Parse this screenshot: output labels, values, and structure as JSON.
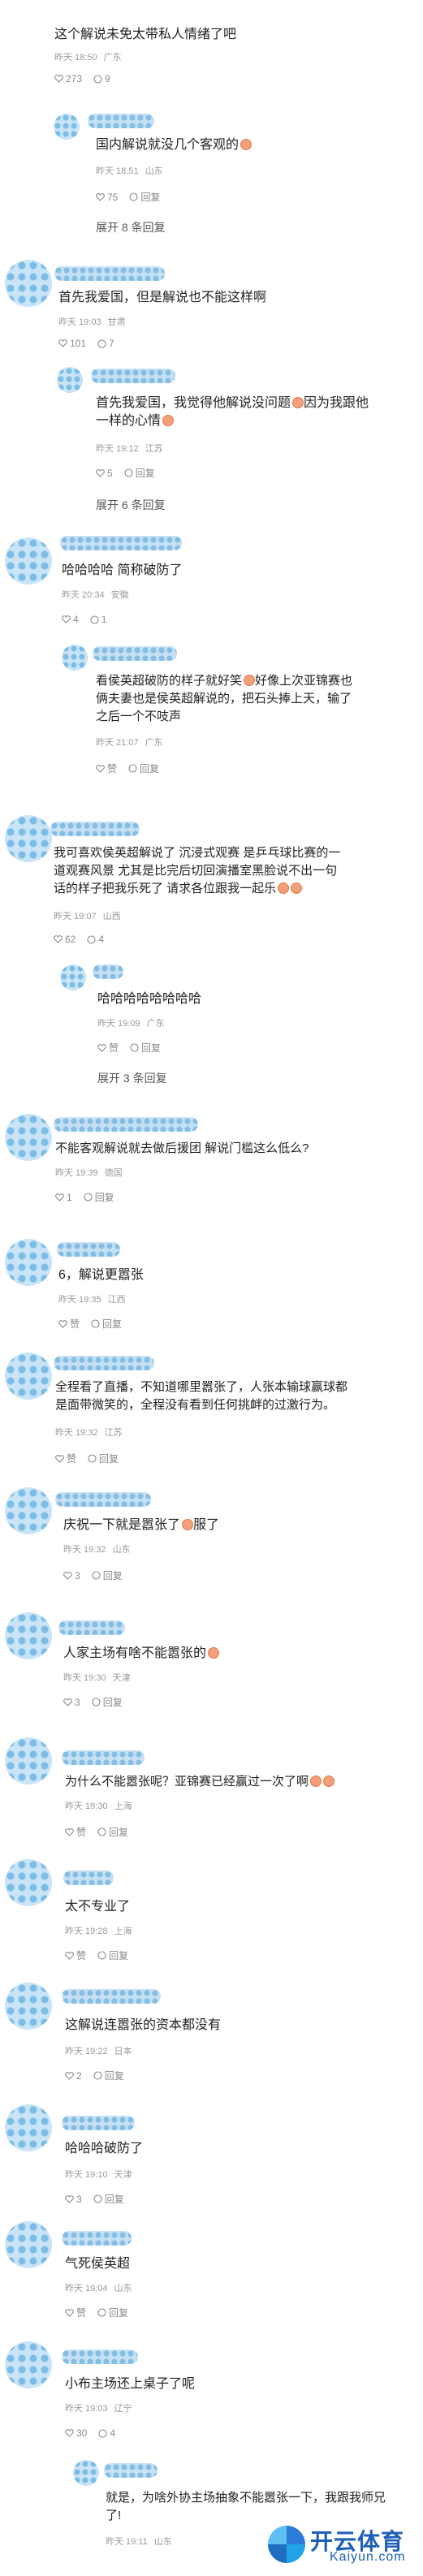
{
  "colors": {
    "accent": "#1e5fb8",
    "meta": "#9a9a9a",
    "avatar": "#c9e4f7"
  },
  "labels": {
    "reply": "回复",
    "like": "赞"
  },
  "comments": [
    {
      "text": "这个解说未免太带私人情绪了吧",
      "time": "昨天 18:50",
      "loc": "广东",
      "likes": "273",
      "replies": "9"
    },
    {
      "text": "国内解说就没几个客观的",
      "time": "昨天 18:51",
      "loc": "山东",
      "likes": "75",
      "reply": "回复",
      "expand": "展开 8 条回复"
    },
    {
      "text": "首先我爱国，但是解说也不能这样啊",
      "time": "昨天 19:03",
      "loc": "甘肃",
      "likes": "101",
      "replies": "7"
    },
    {
      "text": "首先我爱国，我觉得他解说没问题",
      "text2": "因为我跟他",
      "text3": "一样的心情",
      "time": "昨天 19:12",
      "loc": "江苏",
      "likes": "5",
      "reply": "回复",
      "expand": "展开 6 条回复"
    },
    {
      "text": "哈哈哈哈 简称破防了",
      "time": "昨天 20:34",
      "loc": "安徽",
      "likes": "4",
      "replies": "1"
    },
    {
      "text": "看侯英超破防的样子就好笑",
      "text2": "好像上次亚锦赛也",
      "text3": "俩夫妻也是侯英超解说的，把石头捧上天，输了",
      "text4": "之后一个不吱声",
      "time": "昨天 21:07",
      "loc": "广东",
      "likes": "赞",
      "reply": "回复"
    },
    {
      "text": "我可喜欢侯英超解说了 沉浸式观赛 是乒乓球比赛的一",
      "text2": "道观赛风景 尤其是比完后切回演播室黑脸说不出一句",
      "text3": "话的样子把我乐死了 请求各位跟我一起乐",
      "time": "昨天 19:07",
      "loc": "山西",
      "likes": "62",
      "replies": "4"
    },
    {
      "text": "哈哈哈哈哈哈哈哈",
      "time": "昨天 19:09",
      "loc": "广东",
      "likes": "赞",
      "reply": "回复",
      "expand": "展开 3 条回复"
    },
    {
      "text": "不能客观解说就去做后援团 解说门槛这么低么?",
      "time": "昨天 19:39",
      "loc": "德国",
      "likes": "1",
      "reply": "回复"
    },
    {
      "text": "6，解说更嚣张",
      "time": "昨天 19:35",
      "loc": "江西",
      "likes": "赞",
      "reply": "回复"
    },
    {
      "text": "全程看了直播，不知道哪里嚣张了，人张本输球赢球都",
      "text2": "是面带微笑的，全程没有看到任何挑衅的过激行为。",
      "time": "昨天 19:32",
      "loc": "江苏",
      "likes": "赞",
      "reply": "回复"
    },
    {
      "text": "庆祝一下就是嚣张了",
      "text2": "服了",
      "time": "昨天 19:32",
      "loc": "山东",
      "likes": "3",
      "reply": "回复"
    },
    {
      "text": "人家主场有啥不能嚣张的",
      "time": "昨天 19:30",
      "loc": "天津",
      "likes": "3",
      "reply": "回复"
    },
    {
      "text": "为什么不能嚣张呢？亚锦赛已经赢过一次了啊",
      "time": "昨天 19:30",
      "loc": "上海",
      "likes": "赞",
      "reply": "回复"
    },
    {
      "text": "太不专业了",
      "time": "昨天 19:28",
      "loc": "上海",
      "likes": "赞",
      "reply": "回复"
    },
    {
      "text": "这解说连嚣张的资本都没有",
      "time": "昨天 19:22",
      "loc": "日本",
      "likes": "2",
      "reply": "回复"
    },
    {
      "text": "哈哈哈破防了",
      "time": "昨天 19:10",
      "loc": "天津",
      "likes": "3",
      "reply": "回复"
    },
    {
      "text": "气死侯英超",
      "time": "昨天 19:04",
      "loc": "山东",
      "likes": "赞",
      "reply": "回复"
    },
    {
      "text": "小布主场还上桌子了呢",
      "time": "昨天 19:03",
      "loc": "辽宁",
      "likes": "30",
      "replies": "4"
    },
    {
      "text": "就是，为啥外协主场抽象不能嚣张一下，我跟我师兄",
      "text2": "了!",
      "time": "昨天 19:11",
      "loc": "山东"
    }
  ],
  "logo": {
    "title": "开云体育",
    "sub": "Kaiyun.com"
  }
}
